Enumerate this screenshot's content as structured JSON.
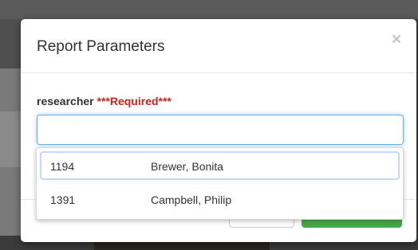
{
  "modal": {
    "title": "Report Parameters",
    "close_glyph": "×"
  },
  "field": {
    "label": "researcher",
    "required_text": "***Required***",
    "value": ""
  },
  "dropdown": {
    "options": [
      {
        "id": "1194",
        "name": "Brewer, Bonita",
        "active": true
      },
      {
        "id": "1391",
        "name": "Campbell, Philip",
        "active": false
      }
    ]
  },
  "colors": {
    "required": "#d4211c",
    "focus_border": "#66afe9",
    "primary_button": "#48a845"
  },
  "icons": {
    "close": "close-icon"
  }
}
